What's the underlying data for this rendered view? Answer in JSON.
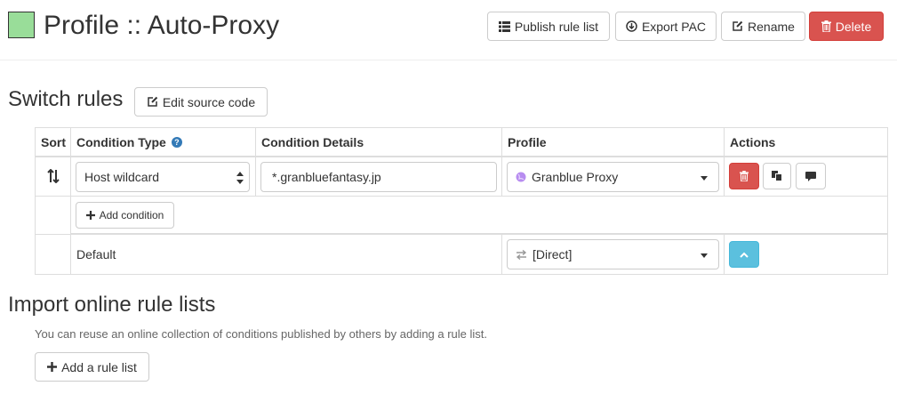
{
  "header": {
    "title": "Profile :: Auto-Proxy",
    "color": "#99dd99",
    "buttons": {
      "publish": "Publish rule list",
      "export": "Export PAC",
      "rename": "Rename",
      "delete": "Delete"
    }
  },
  "switch_rules": {
    "heading": "Switch rules",
    "edit_source": "Edit source code",
    "columns": {
      "sort": "Sort",
      "condition_type": "Condition Type",
      "condition_details": "Condition Details",
      "profile": "Profile",
      "actions": "Actions"
    },
    "rules": [
      {
        "condition_type": "Host wildcard",
        "condition_details": "*.granbluefantasy.jp",
        "profile": "Granblue Proxy"
      }
    ],
    "add_condition": "Add condition",
    "default": {
      "label": "Default",
      "profile": "[Direct]"
    }
  },
  "import": {
    "heading": "Import online rule lists",
    "description": "You can reuse an online collection of conditions published by others by adding a rule list.",
    "add_button": "Add a rule list"
  },
  "icons": {
    "publish": "list-icon",
    "export": "download-icon",
    "rename": "edit-icon",
    "delete": "trash-icon",
    "sort": "sort-arrows-icon",
    "help": "question-circle-icon",
    "profile": "globe-icon",
    "direct": "transfer-arrows-icon",
    "row_delete": "trash-icon",
    "row_clone": "copy-icon",
    "row_note": "comment-icon",
    "add": "plus-icon",
    "default_up": "chevron-up-icon"
  },
  "colors": {
    "danger": "#d9534f",
    "info": "#5bc0de",
    "help": "#337ab7",
    "profile_globe": "#b78cf0"
  }
}
